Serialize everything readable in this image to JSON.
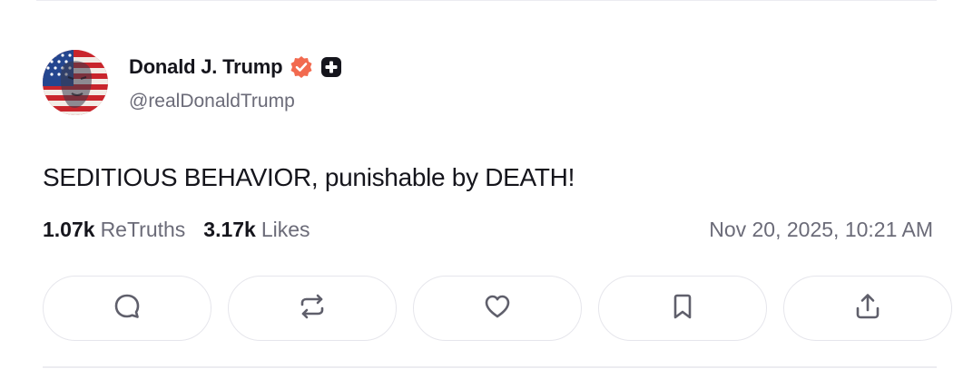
{
  "post": {
    "author": {
      "display_name": "Donald J. Trump",
      "handle": "@realDonaldTrump",
      "avatar_icon": "avatar-flag-portrait",
      "verified_icon": "verified-badge-icon",
      "verified_color": "#f26a4f",
      "tplus_icon": "truth-plus-badge-icon"
    },
    "text": "SEDITIOUS BEHAVIOR, punishable by DEATH!",
    "stats": {
      "retruths_count": "1.07k",
      "retruths_label": "ReTruths",
      "likes_count": "3.17k",
      "likes_label": "Likes"
    },
    "timestamp": "Nov 20, 2025, 10:21 AM",
    "actions": [
      {
        "icon": "reply-icon"
      },
      {
        "icon": "retruth-icon"
      },
      {
        "icon": "like-icon"
      },
      {
        "icon": "bookmark-icon"
      },
      {
        "icon": "share-icon"
      }
    ]
  },
  "colors": {
    "text": "#15151c",
    "muted": "#6b6b78",
    "border": "#e6e6ec",
    "icon": "#5f5f6b"
  }
}
